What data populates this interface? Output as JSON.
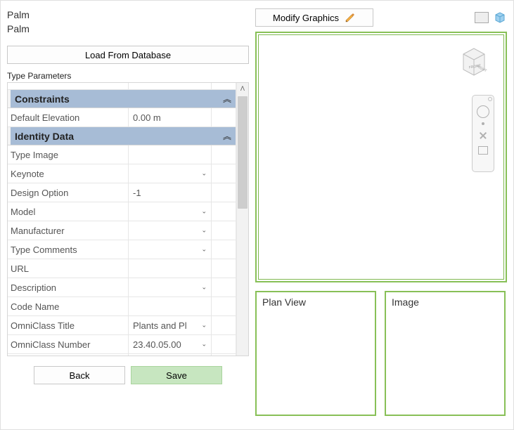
{
  "header": {
    "title1": "Palm",
    "title2": "Palm",
    "load_label": "Load From Database"
  },
  "type_params_label": "Type Parameters",
  "groups": {
    "constraints": {
      "label": "Constraints"
    },
    "identity": {
      "label": "Identity Data"
    }
  },
  "params": {
    "default_elevation": {
      "name": "Default Elevation",
      "value": "0.00 m",
      "hasDropdown": false
    },
    "type_image": {
      "name": "Type Image",
      "value": "",
      "hasDropdown": false
    },
    "keynote": {
      "name": "Keynote",
      "value": "",
      "hasDropdown": true
    },
    "design_option": {
      "name": "Design Option",
      "value": "-1",
      "hasDropdown": false
    },
    "model": {
      "name": "Model",
      "value": "",
      "hasDropdown": true
    },
    "manufacturer": {
      "name": "Manufacturer",
      "value": "",
      "hasDropdown": true
    },
    "type_comments": {
      "name": "Type Comments",
      "value": "",
      "hasDropdown": true
    },
    "url": {
      "name": "URL",
      "value": "",
      "hasDropdown": false
    },
    "description": {
      "name": "Description",
      "value": "",
      "hasDropdown": true
    },
    "code_name": {
      "name": "Code Name",
      "value": "",
      "hasDropdown": false
    },
    "omniclass_title": {
      "name": "OmniClass Title",
      "value": "Plants and Pl",
      "hasDropdown": true
    },
    "omniclass_number": {
      "name": "OmniClass Number",
      "value": "23.40.05.00",
      "hasDropdown": true
    }
  },
  "buttons": {
    "back": "Back",
    "save": "Save",
    "modify": "Modify Graphics"
  },
  "views": {
    "plan": "Plan View",
    "image": "Image"
  },
  "icons": {
    "pencil": "pencil-icon",
    "viewcube": "view-cube-icon",
    "toggle2d": "rect-icon",
    "toggle3d": "cube-icon",
    "collapse": "chevron-double-up-icon"
  },
  "colors": {
    "accent_green": "#88c057",
    "group_header": "#a7bcd6",
    "save_btn": "#c7e6c0"
  }
}
